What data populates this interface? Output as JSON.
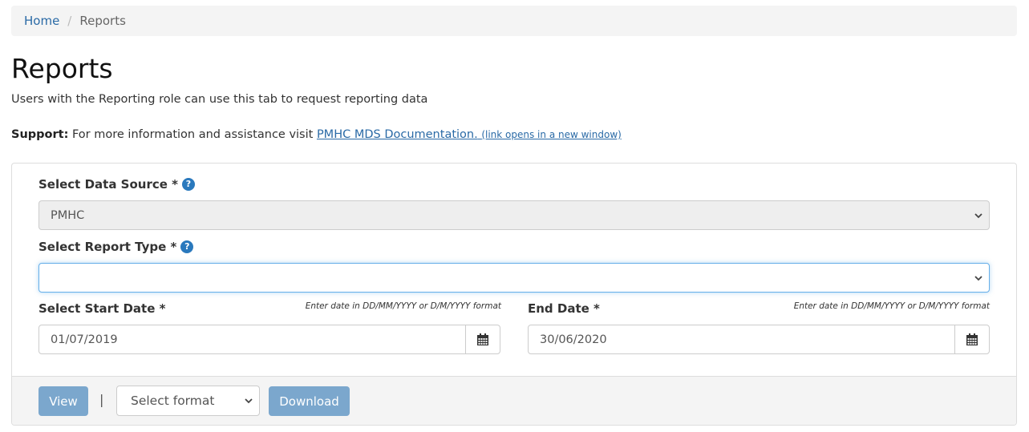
{
  "breadcrumb": {
    "home": "Home",
    "separator": "/",
    "current": "Reports"
  },
  "page": {
    "title": "Reports",
    "subtitle": "Users with the Reporting role can use this tab to request reporting data",
    "support_label": "Support:",
    "support_text": "For more information and assistance visit",
    "support_link": "PMHC MDS Documentation.",
    "support_link_note": "(link opens in a new window)"
  },
  "form": {
    "data_source": {
      "label": "Select Data Source *",
      "help": "?",
      "value": "PMHC"
    },
    "report_type": {
      "label": "Select Report Type *",
      "help": "?",
      "value": ""
    },
    "start_date": {
      "label": "Select Start Date *",
      "hint": "Enter date in DD/MM/YYYY or D/M/YYYY format",
      "value": "01/07/2019"
    },
    "end_date": {
      "label": "End Date *",
      "hint": "Enter date in DD/MM/YYYY or D/M/YYYY format",
      "value": "30/06/2020"
    }
  },
  "footer": {
    "view_label": "View",
    "separator": "|",
    "format_select": "Select format",
    "download_label": "Download"
  },
  "colors": {
    "link": "#2a6aa6",
    "button": "#7ba7cd",
    "help_icon": "#2a79bd"
  }
}
